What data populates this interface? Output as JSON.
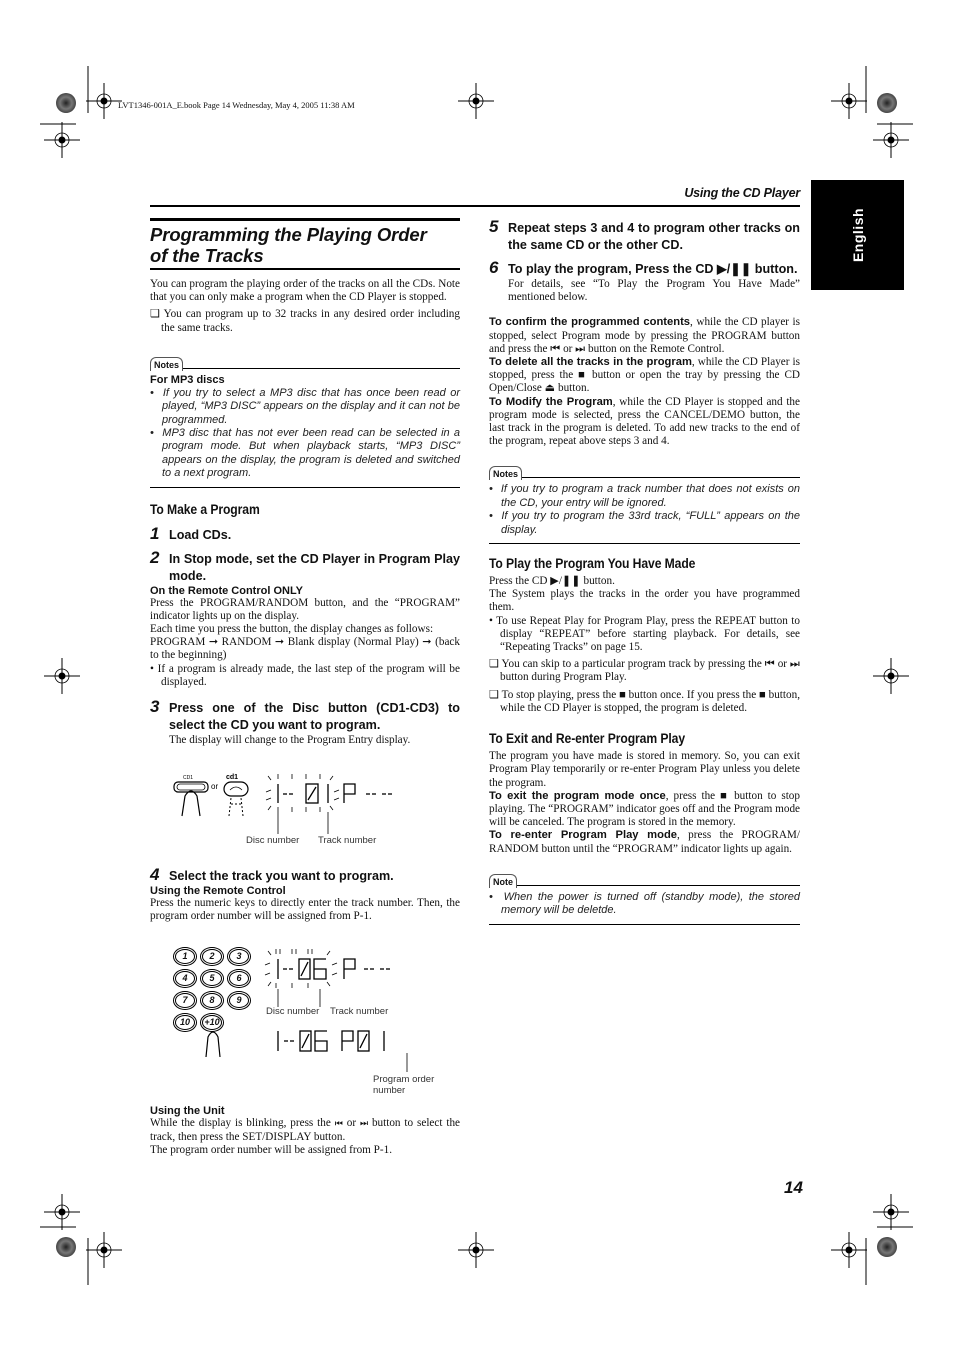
{
  "book_info": "LVT1346-001A_E.book  Page 14  Wednesday, May 4, 2005  11:38 AM",
  "running_head": "Using the CD Player",
  "language_tab": "English",
  "page_number": "14",
  "left": {
    "title_line1": "Programming the Playing Order",
    "title_line2": "of the Tracks",
    "intro": "You can program the playing order of the tracks on all the CDs. Note that you can only make a program when the CD Player is stopped.",
    "intro_check": "❑ You can program up to 32 tracks in any desired order including the same tracks.",
    "notes1": {
      "badge": "Notes",
      "subhead": "For MP3 discs",
      "items": [
        "If you try to select a MP3 disc that has once been read or played, “MP3 DISC” appears on the display and it can not be programmed.",
        "MP3 disc that has not ever been read can be selected in a program mode. But when playback starts, “MP3 DISC” appears on the display, the program is deleted and switched to a next program."
      ]
    },
    "make_program": {
      "heading": "To Make a Program",
      "step1": {
        "num": "1",
        "text": "Load CDs."
      },
      "step2": {
        "num": "2",
        "text": "In Stop mode, set the CD Player in Program Play mode."
      },
      "remote_only_head": "On the Remote Control ONLY",
      "remote_only_p1": "Press the PROGRAM/RANDOM button, and the “PROGRAM” indicator lights up on the display.",
      "remote_only_p2": "Each time you press the button, the display changes as follows:",
      "remote_only_p3": "PROGRAM ➞ RANDOM ➞ Blank display (Normal Play) ➞ (back to the beginning)",
      "remote_only_bullet": "• If a program is already made, the last step of the program will be displayed.",
      "step3": {
        "num": "3",
        "text": "Press one of the Disc button (CD1-CD3) to select the CD you want to program."
      },
      "step3_desc": "The display will change to the Program Entry display.",
      "fig1": {
        "button_label_a": "CD1",
        "button_label_b": "cd1",
        "or": "or",
        "display": "1-- 0 1 P -- --",
        "label_disc": "Disc number",
        "label_track": "Track number"
      },
      "step4": {
        "num": "4",
        "text": "Select the track you want to program."
      },
      "remote_head": "Using the Remote Control",
      "remote_text": "Press the numeric keys to directly enter the track number. Then, the program order number will be assigned from P-1.",
      "fig2": {
        "keys": [
          "1",
          "2",
          "3",
          "4",
          "5",
          "6",
          "7",
          "8",
          "9",
          "10",
          "+10"
        ],
        "display_blink": "1-- 06 P -- --",
        "display_final": "1-- 06 P 01",
        "label_disc": "Disc number",
        "label_track": "Track number",
        "label_order_1": "Program order",
        "label_order_2": "number"
      },
      "unit_head": "Using the Unit",
      "unit_text_a": "While the display is blinking, press the",
      "unit_text_prev": "⏮",
      "unit_text_or": "or",
      "unit_text_next": "⏭",
      "unit_text_b": "button to select the track, then press the SET/DISPLAY button.",
      "unit_text_c": "The program order number will be assigned from P-1."
    }
  },
  "right": {
    "step5": {
      "num": "5",
      "text": "Repeat steps 3 and 4 to program other tracks on the same CD or the other CD."
    },
    "step6": {
      "num": "6",
      "text": "To play the program, Press the CD ▶/❚❚ button."
    },
    "step6_desc": "For details, see “To Play the Program You Have Made” mentioned below.",
    "confirm_bold": "To confirm the programmed contents",
    "confirm_text": ", while the CD player is stopped, select Program mode by pressing the PROGRAM button and press the ⏮ or ⏭ button on the Remote Control.",
    "delete_bold": "To delete all the tracks in the program",
    "delete_text": ", while the CD Player is stopped, press the ■ button or open the tray by pressing the CD Open/Close ⏏ button.",
    "modify_bold": "To Modify the Program",
    "modify_text": ", while the CD Player is stopped and the program mode is selected, press the CANCEL/DEMO button, the last track in the program is deleted. To add new tracks to the end of the program, repeat above steps 3 and 4.",
    "notes2": {
      "badge": "Notes",
      "items": [
        "If you try to program a track number that does not exists on the CD, your entry will be ignored.",
        "If you try to program the 33rd track, “FULL” appears on the display."
      ]
    },
    "play_program": {
      "heading": "To Play the Program You Have Made",
      "p1": "Press the CD ▶/❚❚ button.",
      "p2": "The System plays the tracks in the order you have programmed them.",
      "bullet": "• To use Repeat Play for Program Play, press the REPEAT button to display “REPEAT” before starting playback. For details, see “Repeating Tracks” on page 15.",
      "check1": "❑ You can skip to a particular program track by pressing the ⏮ or ⏭ button during Program Play.",
      "check2": "❑ To stop playing, press the ■ button once. If you press the ■ button, while the CD Player is stopped, the program is deleted."
    },
    "exit_reenter": {
      "heading": "To Exit and Re-enter Program Play",
      "p1": "The program you have made is stored in memory. So, you can exit Program Play temporarily or re-enter Program Play unless you delete the program.",
      "exit_bold": "To exit the program mode once",
      "exit_text": ", press the ■ button to stop playing. The “PROGRAM” indicator goes off and the Program mode will be canceled. The program is stored in the memory.",
      "reenter_bold": "To re-enter Program Play mode",
      "reenter_text": ", press the PROGRAM/ RANDOM button until the “PROGRAM” indicator lights up again."
    },
    "note3": {
      "badge": "Note",
      "items": [
        "When the power is turned off (standby mode), the stored memory will be deletde."
      ]
    }
  }
}
